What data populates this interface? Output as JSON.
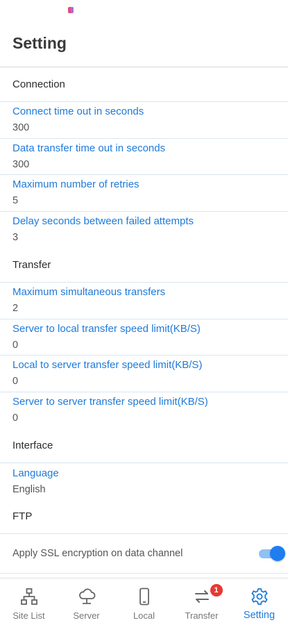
{
  "app": {
    "title": "Setting"
  },
  "sections": {
    "connection": {
      "header": "Connection",
      "items": [
        {
          "title": "Connect time out in seconds",
          "value": "300"
        },
        {
          "title": "Data transfer time out in seconds",
          "value": "300"
        },
        {
          "title": "Maximum number of retries",
          "value": "5"
        },
        {
          "title": "Delay seconds between failed attempts",
          "value": "3"
        }
      ]
    },
    "transfer": {
      "header": "Transfer",
      "items": [
        {
          "title": "Maximum simultaneous transfers",
          "value": "2"
        },
        {
          "title": "Server to local transfer speed limit(KB/S)",
          "value": "0"
        },
        {
          "title": "Local to server transfer speed limit(KB/S)",
          "value": "0"
        },
        {
          "title": "Server to server transfer speed limit(KB/S)",
          "value": "0"
        }
      ]
    },
    "interface": {
      "header": "Interface",
      "items": [
        {
          "title": "Language",
          "value": "English"
        }
      ]
    },
    "ftp": {
      "header": "FTP",
      "toggle": {
        "label": "Apply SSL encryption on data channel",
        "enabled": true
      }
    }
  },
  "nav": {
    "items": [
      {
        "label": "Site List",
        "icon": "sitemap-icon"
      },
      {
        "label": "Server",
        "icon": "cloud-server-icon"
      },
      {
        "label": "Local",
        "icon": "phone-icon"
      },
      {
        "label": "Transfer",
        "icon": "transfer-arrows-icon",
        "badge": "1"
      },
      {
        "label": "Setting",
        "icon": "gear-icon",
        "active": true
      }
    ]
  },
  "colors": {
    "accent": "#1e7ad9",
    "badge": "#e53935",
    "toggle_on": "#1e7ef0"
  }
}
